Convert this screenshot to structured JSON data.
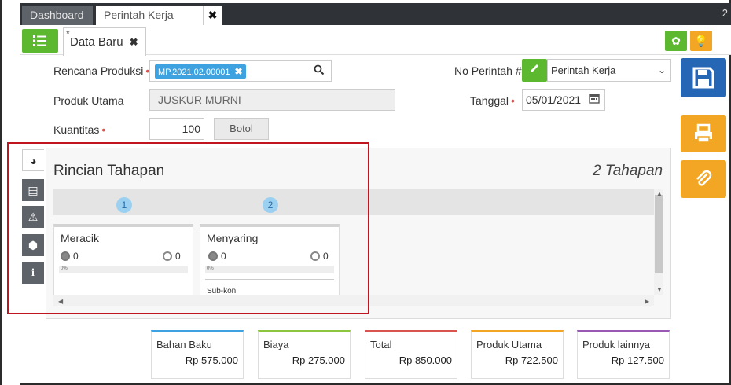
{
  "tabs": {
    "dashboard": "Dashboard",
    "perintah_kerja": "Perintah Kerja",
    "close": "✖",
    "counter": "2"
  },
  "subtab": {
    "star": "*",
    "label": "Data Baru",
    "close": "✖"
  },
  "form": {
    "rencana_produksi": {
      "label": "Rencana Produksi",
      "required": "•",
      "value": "MP.2021.02.00001",
      "remove": "✖"
    },
    "produk_utama": {
      "label": "Produk Utama",
      "value": "JUSKUR MURNI"
    },
    "kuantitas": {
      "label": "Kuantitas",
      "required": "•",
      "value": "100",
      "unit": "Botol"
    },
    "no_perintah": {
      "label": "No Perintah #",
      "value": "Perintah Kerja"
    },
    "tanggal": {
      "label": "Tanggal",
      "required": "•",
      "value": "05/01/2021"
    }
  },
  "panel": {
    "title": "Rincian Tahapan",
    "count": "2 Tahapan",
    "steps": [
      {
        "number": "1",
        "name": "Meracik",
        "left_count": "0",
        "right_count": "0",
        "progress": "0%",
        "progress_value": 0,
        "sub": ""
      },
      {
        "number": "2",
        "name": "Menyaring",
        "left_count": "0",
        "right_count": "0",
        "progress": "0%",
        "progress_value": 0,
        "sub": "Sub-kon"
      }
    ]
  },
  "summary": [
    {
      "title": "Bahan Baku",
      "value": "Rp 575.000",
      "color": "#3ea2e0"
    },
    {
      "title": "Biaya",
      "value": "Rp 275.000",
      "color": "#8cc63f"
    },
    {
      "title": "Total",
      "value": "Rp 850.000",
      "color": "#d9534f"
    },
    {
      "title": "Produk Utama",
      "value": "Rp 722.500",
      "color": "#f2a623"
    },
    {
      "title": "Produk lainnya",
      "value": "Rp 127.500",
      "color": "#9b59b6"
    }
  ],
  "colors": {
    "green": "#5cb82f",
    "blue": "#2566b5",
    "orange": "#f2a623",
    "highlight_red": "#c0151e"
  },
  "icons": [
    "list-icon",
    "gear-icon",
    "bulb-icon",
    "search-icon",
    "pencil-icon",
    "chevron-down-icon",
    "calendar-icon",
    "save-icon",
    "print-icon",
    "paperclip-icon",
    "pie-icon",
    "document-icon",
    "alert-icon",
    "box-icon",
    "info-icon"
  ]
}
